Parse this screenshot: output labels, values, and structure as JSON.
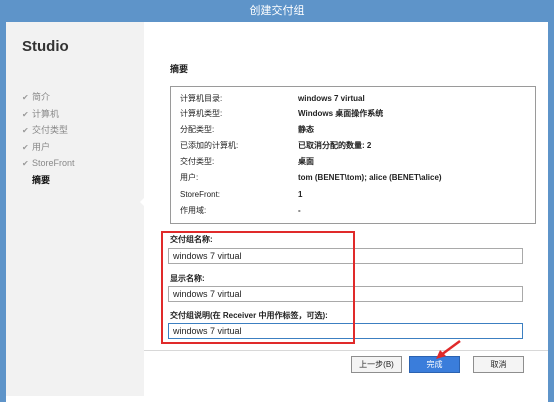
{
  "window": {
    "title": "创建交付组"
  },
  "sidebar": {
    "brand": "Studio",
    "items": [
      {
        "label": "简介"
      },
      {
        "label": "计算机"
      },
      {
        "label": "交付类型"
      },
      {
        "label": "用户"
      },
      {
        "label": "StoreFront"
      },
      {
        "label": "摘要"
      }
    ]
  },
  "page": {
    "heading": "摘要",
    "summary": [
      {
        "label": "计算机目录:",
        "value": "windows 7 virtual"
      },
      {
        "label": "计算机类型:",
        "value": "Windows 桌面操作系统"
      },
      {
        "label": "分配类型:",
        "value": "静态"
      },
      {
        "label": "已添加的计算机:",
        "value": "已取消分配的数量: 2"
      },
      {
        "label": "交付类型:",
        "value": "桌面"
      },
      {
        "label": "用户:",
        "value": "tom (BENET\\tom); alice (BENET\\alice)"
      },
      {
        "label": "StoreFront:",
        "value": "1"
      },
      {
        "label": "作用域:",
        "value": "-"
      }
    ],
    "fields": {
      "group_name_label": "交付组名称:",
      "group_name_value": "windows 7 virtual",
      "display_name_label": "显示名称:",
      "display_name_value": "windows 7 virtual",
      "description_label": "交付组说明(在 Receiver 中用作标签，可选):",
      "description_value": "windows 7 virtual"
    }
  },
  "buttons": {
    "back": "上一步(B)",
    "finish": "完成",
    "cancel": "取消"
  },
  "colors": {
    "titlebar": "#5e94c9",
    "primary_button": "#3a7ddb",
    "annotation_red": "#e02a2a"
  }
}
